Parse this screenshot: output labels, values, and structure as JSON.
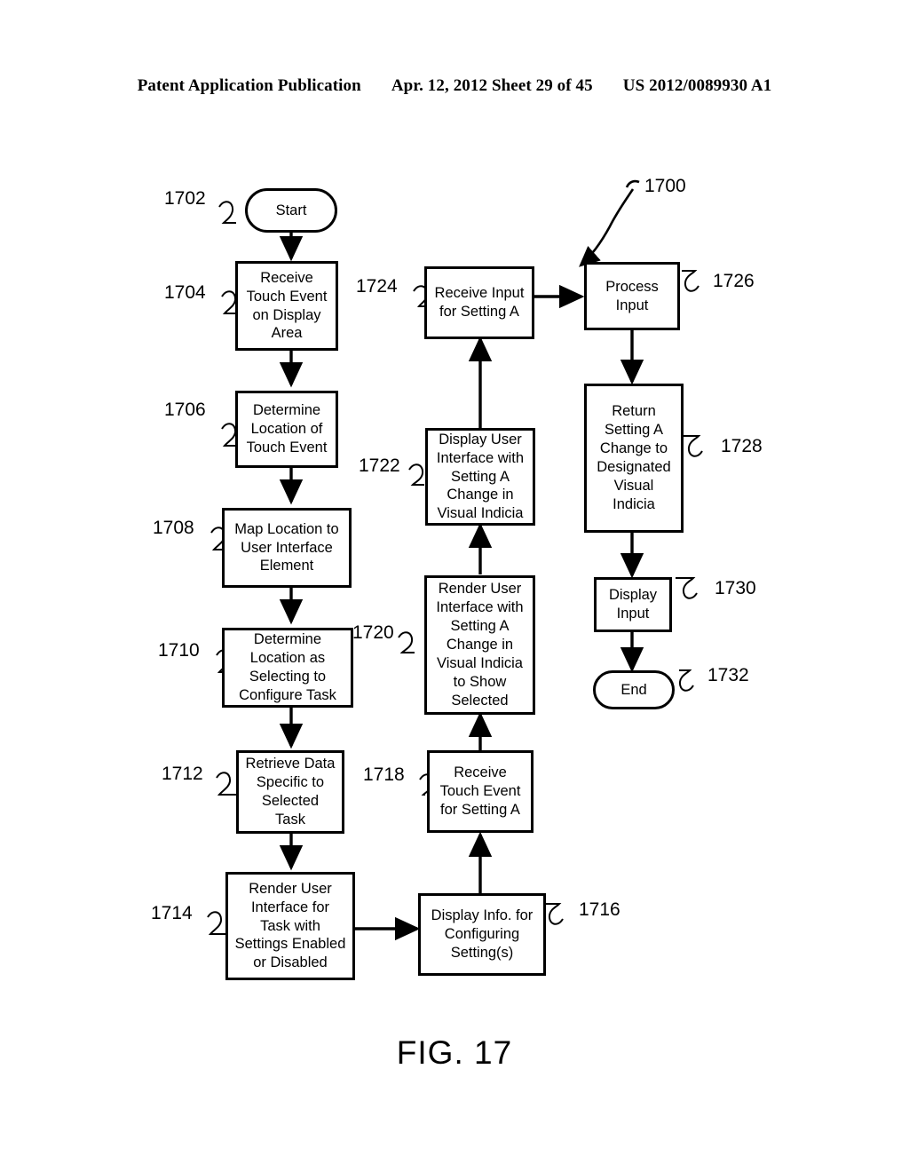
{
  "header": {
    "publication": "Patent Application Publication",
    "date_sheet": "Apr. 12, 2012  Sheet 29 of 45",
    "patent_number": "US 2012/0089930 A1"
  },
  "figure": {
    "caption": "FIG. 17",
    "flow_reference": "1700",
    "nodes": [
      {
        "ref": "1702",
        "shape": "terminal",
        "text": "Start"
      },
      {
        "ref": "1704",
        "shape": "process",
        "text": "Receive\nTouch Event\non Display\nArea"
      },
      {
        "ref": "1706",
        "shape": "process",
        "text": "Determine\nLocation of\nTouch Event"
      },
      {
        "ref": "1708",
        "shape": "process",
        "text": "Map Location to\nUser Interface\nElement"
      },
      {
        "ref": "1710",
        "shape": "process",
        "text": "Determine\nLocation as\nSelecting to\nConfigure Task"
      },
      {
        "ref": "1712",
        "shape": "process",
        "text": "Retrieve Data\nSpecific to\nSelected\nTask"
      },
      {
        "ref": "1714",
        "shape": "process",
        "text": "Render User\nInterface for\nTask with\nSettings Enabled\nor Disabled"
      },
      {
        "ref": "1716",
        "shape": "process",
        "text": "Display Info. for\nConfiguring\nSetting(s)"
      },
      {
        "ref": "1718",
        "shape": "process",
        "text": "Receive\nTouch Event\nfor Setting A"
      },
      {
        "ref": "1720",
        "shape": "process",
        "text": "Render User\nInterface with\nSetting A\nChange in\nVisual Indicia\nto Show\nSelected"
      },
      {
        "ref": "1722",
        "shape": "process",
        "text": "Display User\nInterface with\nSetting A\nChange in\nVisual Indicia"
      },
      {
        "ref": "1724",
        "shape": "process",
        "text": "Receive Input\nfor Setting A"
      },
      {
        "ref": "1726",
        "shape": "process",
        "text": "Process\nInput"
      },
      {
        "ref": "1728",
        "shape": "process",
        "text": "Return\nSetting A\nChange to\nDesignated\nVisual\nIndicia"
      },
      {
        "ref": "1730",
        "shape": "process",
        "text": "Display\nInput"
      },
      {
        "ref": "1732",
        "shape": "terminal",
        "text": "End"
      }
    ]
  }
}
